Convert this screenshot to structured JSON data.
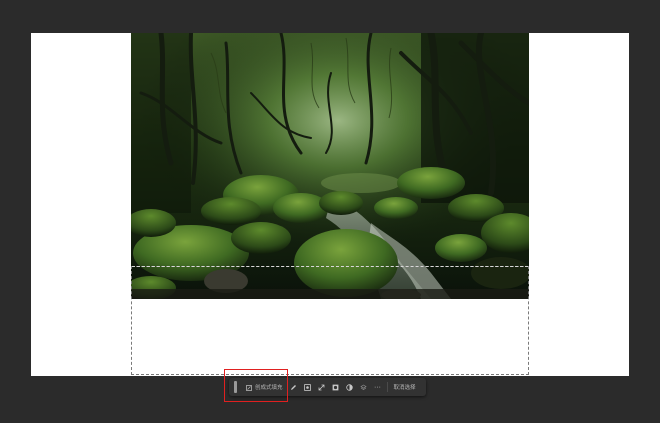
{
  "taskbar": {
    "generative_fill_label": "创成式填充",
    "deselect_label": "取消选择",
    "more_label": "···",
    "icons": [
      "pencil-icon",
      "select-subject-icon",
      "transform-icon",
      "mask-icon",
      "adjustment-icon",
      "layer-icon",
      "more-icon"
    ]
  },
  "colors": {
    "workspace": "#2b2b2b",
    "canvas": "#ffffff",
    "taskbar": "#323232",
    "highlight": "#e02020"
  }
}
